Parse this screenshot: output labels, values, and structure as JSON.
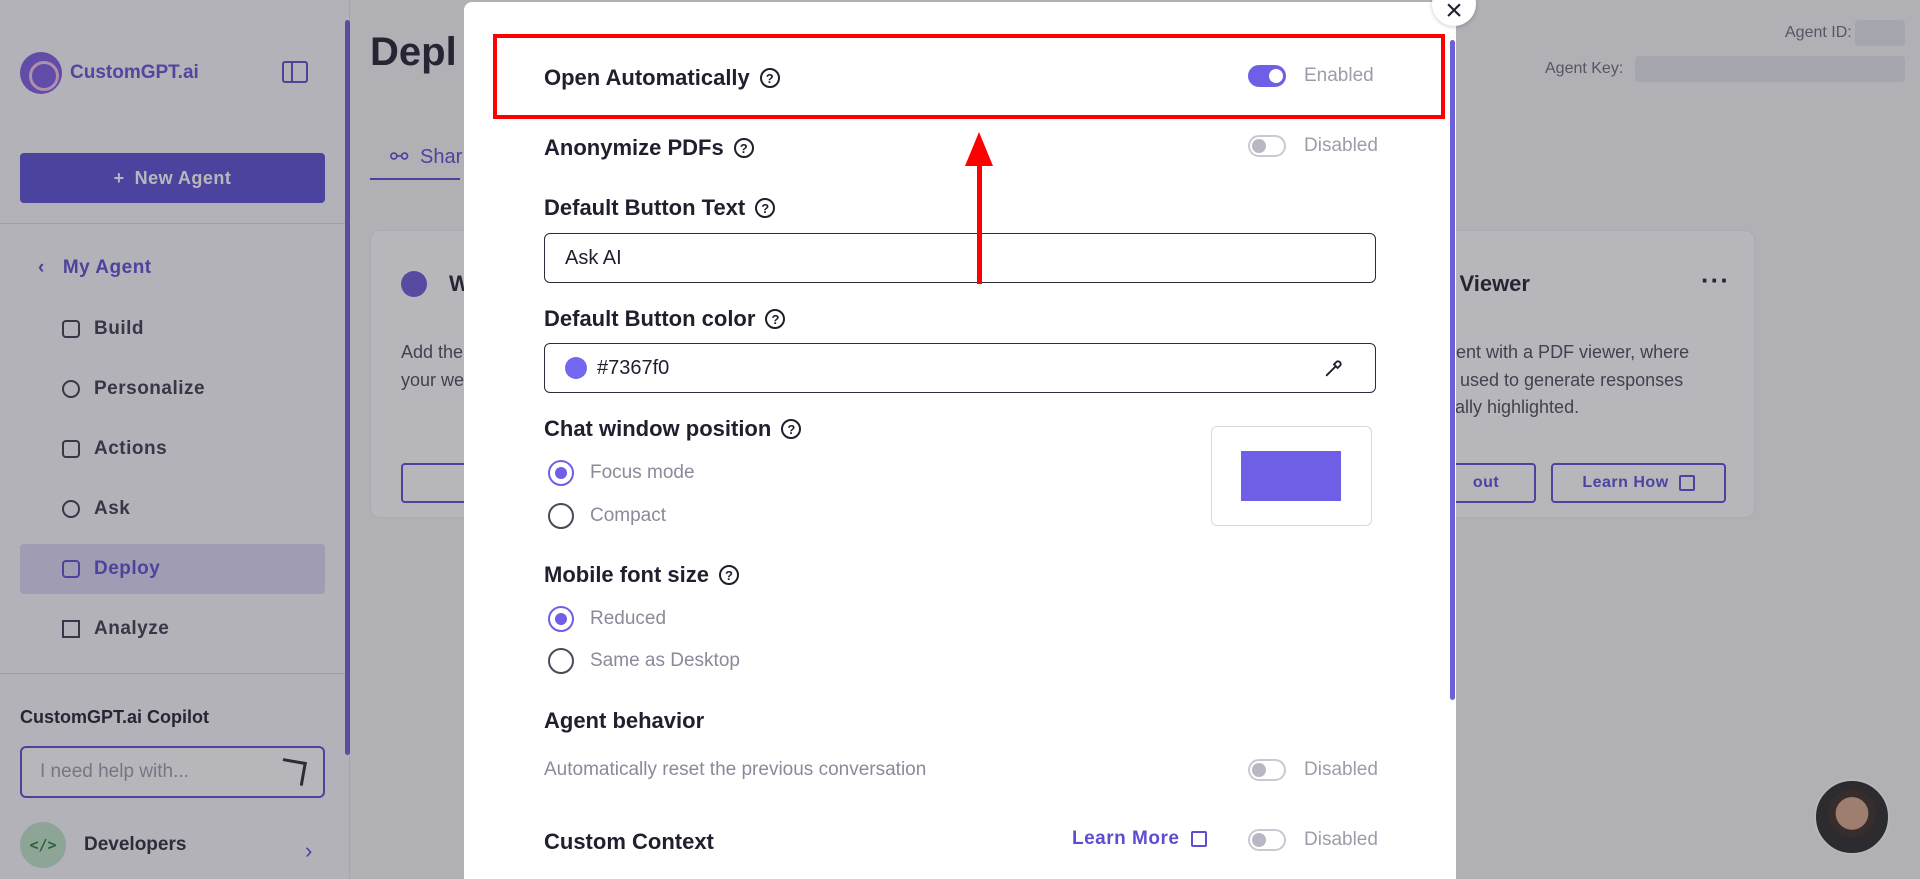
{
  "sidebar": {
    "logo_text": "CustomGPT.ai",
    "new_agent_label": "New Agent",
    "my_agent_label": "My Agent",
    "items": [
      {
        "label": "Build"
      },
      {
        "label": "Personalize"
      },
      {
        "label": "Actions"
      },
      {
        "label": "Ask"
      },
      {
        "label": "Deploy"
      },
      {
        "label": "Analyze"
      }
    ],
    "active_item": "Deploy",
    "copilot_title": "CustomGPT.ai Copilot",
    "copilot_placeholder": "I need help with...",
    "developers_badge": "</>",
    "developers_label": "Developers"
  },
  "main": {
    "page_title_visible": "Depl",
    "agent_id_label": "Agent ID:",
    "agent_key_label": "Agent Key:",
    "share_tab_label": "Shar",
    "left_card_heading": "W",
    "left_card_text": [
      "Add the",
      "your we"
    ],
    "right_card_heading": "t Viewer",
    "right_card_text": [
      "gent with a PDF viewer, where",
      "s used to generate responses",
      "cally highlighted."
    ],
    "right_card_btn1": "out",
    "right_card_btn2": "Learn How"
  },
  "modal": {
    "open_automatically": {
      "label": "Open Automatically",
      "enabled": true,
      "state_text": "Enabled"
    },
    "anonymize_pdfs": {
      "label": "Anonymize PDFs",
      "enabled": false,
      "state_text": "Disabled"
    },
    "default_button_text": {
      "label": "Default Button Text",
      "value": "Ask AI"
    },
    "default_button_color": {
      "label": "Default Button color",
      "value": "#7367f0"
    },
    "chat_window_position": {
      "label": "Chat window position",
      "options": [
        "Focus mode",
        "Compact"
      ],
      "selected": "Focus mode"
    },
    "mobile_font_size": {
      "label": "Mobile font size",
      "options": [
        "Reduced",
        "Same as Desktop"
      ],
      "selected": "Reduced"
    },
    "agent_behavior": {
      "label": "Agent behavior",
      "description": "Automatically reset the previous conversation",
      "enabled": false,
      "state_text": "Disabled"
    },
    "custom_context": {
      "label": "Custom Context",
      "learn_more": "Learn More",
      "enabled": false,
      "state_text": "Disabled"
    }
  },
  "colors": {
    "accent": "#5b4ed3",
    "toggle_on": "#6f5fe6",
    "highlight": "#ff0000"
  }
}
